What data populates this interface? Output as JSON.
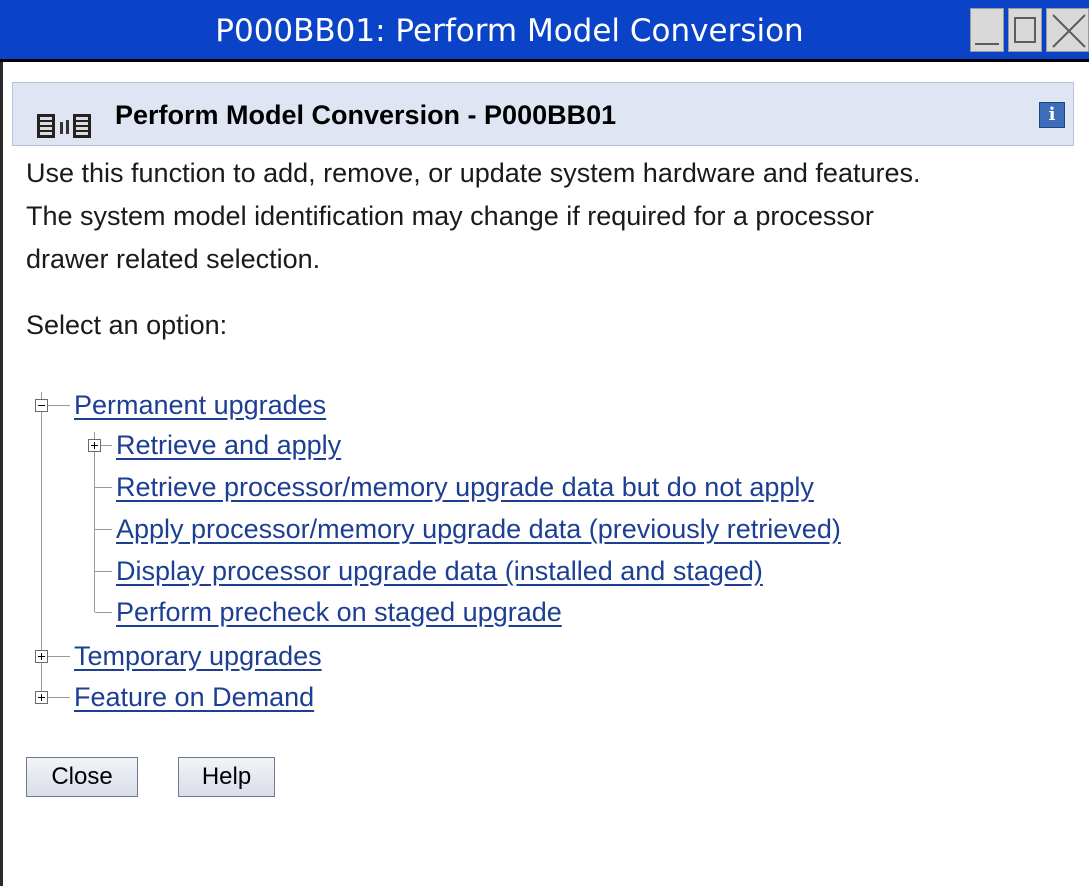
{
  "window": {
    "title": "P000BB01: Perform Model Conversion",
    "controls": [
      "minimize-icon",
      "maximize-icon",
      "close-icon"
    ]
  },
  "header": {
    "title": "Perform Model Conversion - P000BB01",
    "info_label": "i"
  },
  "description": {
    "line1": "Use this function to add, remove, or update system hardware and features.",
    "line2": "The system model identification may change if required for a processor",
    "line3": "drawer related selection."
  },
  "prompt": "Select an option:",
  "tree": {
    "permanent": {
      "label": "Permanent upgrades",
      "children": [
        "Retrieve and apply",
        "Retrieve processor/memory upgrade data but do not apply",
        "Apply processor/memory upgrade data (previously retrieved)",
        "Display processor upgrade data (installed and staged)",
        "Perform precheck on staged upgrade"
      ]
    },
    "temporary": {
      "label": "Temporary upgrades"
    },
    "feature": {
      "label": "Feature on Demand"
    }
  },
  "buttons": {
    "close": "Close",
    "help": "Help"
  },
  "colors": {
    "titlebar": "#0a43c8",
    "header_band": "#dfe5f3",
    "link": "#1c3f94"
  }
}
